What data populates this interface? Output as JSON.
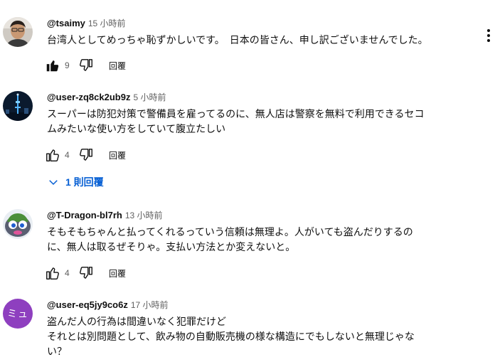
{
  "comments": [
    {
      "author": "@tsaimy",
      "time": "15 小時前",
      "text": [
        "台湾人としてめっちゃ恥ずかしいです。　日本の皆さん、申し訳ございませんでした。"
      ],
      "likes": "9",
      "reply_label": "回覆",
      "avatar_icon": "person-photo-avatar",
      "like_filled": true
    },
    {
      "author": "@user-zq8ck2ub9z",
      "time": "5 小時前",
      "text": [
        "スーパーは防犯対策で警備員を雇ってるのに、無人店は警察を無料で利用できるセコ",
        "ムみたいな使い方をしていて腹立たしい"
      ],
      "likes": "4",
      "reply_label": "回覆",
      "avatar_icon": "night-tower-avatar",
      "replies_toggle": "1 則回覆"
    },
    {
      "author": "@T-Dragon-bl7rh",
      "time": "13 小時前",
      "text": [
        "そもそもちゃんと払ってくれるっていう信頼は無理よ。人がいても盗んだりするの",
        "に、無人は取るぜそりゃ。支払い方法とか変えないと。"
      ],
      "likes": "4",
      "reply_label": "回覆",
      "avatar_icon": "cartoon-creature-avatar"
    },
    {
      "author": "@user-eq5jy9co6z",
      "time": "17 小時前",
      "text": [
        "盗んだ人の行為は間違いなく犯罪だけど",
        "それとは別問題として、飲み物の自動販売機の様な構造にでもしないと無理じゃな",
        "い？"
      ],
      "avatar_letter": "ミュ",
      "avatar_color": "#8e3fbf"
    }
  ],
  "icons": {
    "like": "thumb-up-icon",
    "dislike": "thumb-down-icon",
    "more": "more-vert-icon",
    "expand": "chevron-down-icon"
  },
  "colors": {
    "link_blue": "#065fd4",
    "secondary_text": "#606060"
  }
}
